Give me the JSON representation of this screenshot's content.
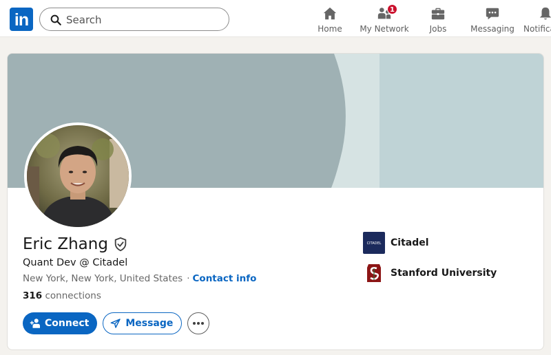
{
  "nav": {
    "logo_text": "in",
    "search": {
      "placeholder": "Search"
    },
    "items": [
      {
        "label": "Home",
        "icon": "home-icon"
      },
      {
        "label": "My Network",
        "icon": "network-icon",
        "badge": "1"
      },
      {
        "label": "Jobs",
        "icon": "briefcase-icon"
      },
      {
        "label": "Messaging",
        "icon": "messaging-icon"
      },
      {
        "label": "Notifications",
        "icon": "bell-icon"
      }
    ]
  },
  "profile": {
    "name": "Eric Zhang",
    "headline": "Quant Dev @ Citadel",
    "location": "New York, New York, United States",
    "contact_info": "Contact info",
    "connections_count": "316",
    "connections_label": "connections",
    "actions": {
      "connect": "Connect",
      "message": "Message"
    },
    "orgs": [
      {
        "name": "Citadel",
        "logo_text": "CITADEL"
      },
      {
        "name": "Stanford University"
      }
    ]
  },
  "colors": {
    "brand": "#0a66c2",
    "banner_dark": "#9fb1b4",
    "banner_light": "#bfd3d6",
    "badge": "#cb112d",
    "stanford": "#8c1515",
    "citadel": "#1b2a5c"
  }
}
